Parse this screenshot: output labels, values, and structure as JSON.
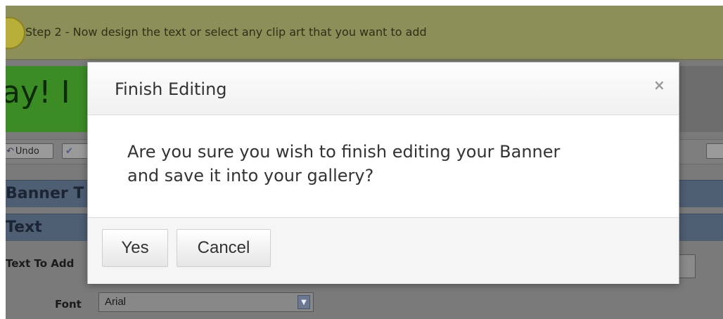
{
  "step_bar": {
    "text": "Step 2 - Now design the text or select any clip art that you want to add"
  },
  "banner": {
    "preview_text": "ay!  I"
  },
  "toolbar": {
    "undo_label": "Undo",
    "undo_icon": "undo-arrow-icon",
    "check_icon": "check-icon"
  },
  "sections": {
    "banner_label": "Banner T",
    "text_label": "Text"
  },
  "form": {
    "text_to_add_label": "Text To Add",
    "font_label": "Font",
    "font_value": "Arial"
  },
  "modal": {
    "title": "Finish Editing",
    "close_glyph": "×",
    "message": "Are you sure you wish to finish editing your Banner and save it into your gallery?",
    "yes_label": "Yes",
    "cancel_label": "Cancel"
  },
  "colors": {
    "step_bar": "#8c8f58",
    "banner_green": "#3c8c26",
    "section_blue": "#4e5e73",
    "modal_bg": "#ffffff",
    "modal_footer": "#f5f5f5"
  }
}
